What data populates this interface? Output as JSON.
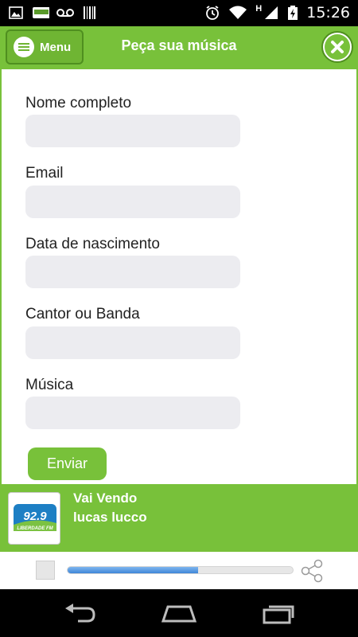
{
  "status_bar": {
    "time": "15:26",
    "icons": [
      "image-icon",
      "app-notification-icon",
      "voicemail-icon",
      "barcode-icon",
      "alarm-icon",
      "wifi-icon",
      "signal-icon",
      "battery-charging-icon"
    ],
    "network_letter": "H"
  },
  "header": {
    "menu_label": "Menu",
    "title": "Peça sua música",
    "close_icon": "close-icon"
  },
  "form": {
    "fields": [
      {
        "label": "Nome completo",
        "value": ""
      },
      {
        "label": "Email",
        "value": ""
      },
      {
        "label": "Data de nascimento",
        "value": ""
      },
      {
        "label": "Cantor ou Banda",
        "value": ""
      },
      {
        "label": "Música",
        "value": ""
      }
    ],
    "submit_label": "Enviar"
  },
  "now_playing": {
    "song": "Vai Vendo",
    "artist": "lucas lucco",
    "logo_number": "92.9",
    "logo_text": "LIBERDADE FM"
  },
  "player": {
    "progress": 0.58,
    "stop_icon": "stop-icon",
    "share_icon": "share-icon"
  },
  "nav_bar": {
    "icons": [
      "back-icon",
      "home-icon",
      "recent-apps-icon"
    ]
  },
  "colors": {
    "accent": "#78c13a",
    "accent_dark": "#4f8f1f",
    "input_bg": "#ececf0",
    "progress": "#3f86d8"
  }
}
